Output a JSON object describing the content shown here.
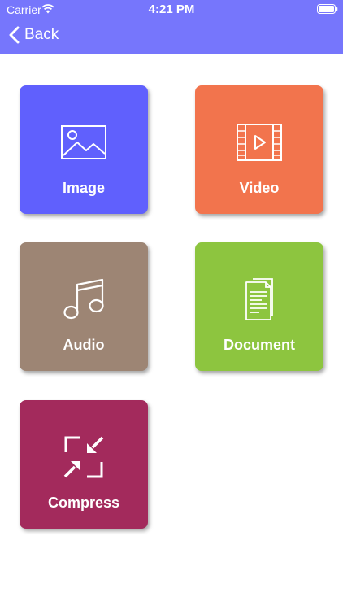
{
  "status_bar": {
    "carrier": "Carrier",
    "time": "4:21 PM"
  },
  "nav": {
    "back_label": "Back",
    "back_icon": "chevron-left-icon"
  },
  "tiles": [
    {
      "label": "Image",
      "color": "#6060fd",
      "icon": "image-icon"
    },
    {
      "label": "Video",
      "color": "#f2744d",
      "icon": "film-icon"
    },
    {
      "label": "Audio",
      "color": "#9d8574",
      "icon": "music-note-icon"
    },
    {
      "label": "Document",
      "color": "#8dc53f",
      "icon": "document-icon"
    },
    {
      "label": "Compress",
      "color": "#a32a5c",
      "icon": "compress-icon"
    }
  ],
  "colors": {
    "header": "#7676fc"
  }
}
